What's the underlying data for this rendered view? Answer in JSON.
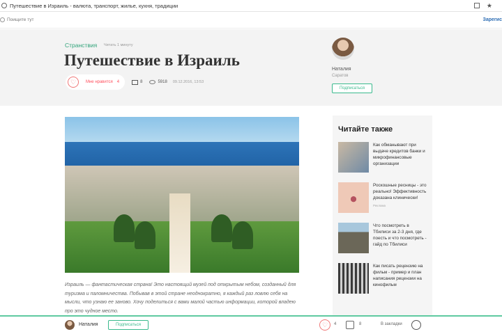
{
  "browser": {
    "url": "Путешествие в Израиль - валюта, транспорт, жилье, кухня, традиции"
  },
  "header": {
    "search_placeholder": "Поищите тут",
    "register_label": "Зарегис"
  },
  "article": {
    "category": "Странствия",
    "read_time": "Читать 1 минуту",
    "title": "Путешествие в Израиль",
    "like_label": "Мне нравится",
    "like_count": "4",
    "comment_count": "8",
    "view_count": "5918",
    "date": "09.12.2016, 13:53",
    "body": "Израиль — фантастическая страна! Это настоящий музей под открытым небом, созданный для туризма и паломничества. Побывав в этой стране неоднократно, я каждый раз ловлю себя на мысли, что узнаю ее заново. Хочу поделиться с вами малой частью информации, которой владею про это чудное место."
  },
  "author": {
    "name": "Наталия",
    "city": "Саратов",
    "subscribe_label": "Подписаться"
  },
  "sidebar": {
    "heading": "Читайте также",
    "items": [
      {
        "title": "Как обманывают при выдаче кредитов банки и микрофинансовые организации",
        "meta": ""
      },
      {
        "title": "Роскошные ресницы - это реально! Эффективность доказана клинически!",
        "meta": "Реклама"
      },
      {
        "title": "Что посмотреть в Тбилиси за 2-3 дня, где поесть и что посмотреть - гайд по Тбилиси",
        "meta": ""
      },
      {
        "title": "Как писать рецензию на фильм - пример и план написания рецензии на кинофильм",
        "meta": ""
      }
    ]
  },
  "bottom_bar": {
    "author_name": "Наталия",
    "subscribe_label": "Подписаться",
    "likes": "4",
    "comments": "8",
    "bookmark_label": "В закладки"
  }
}
